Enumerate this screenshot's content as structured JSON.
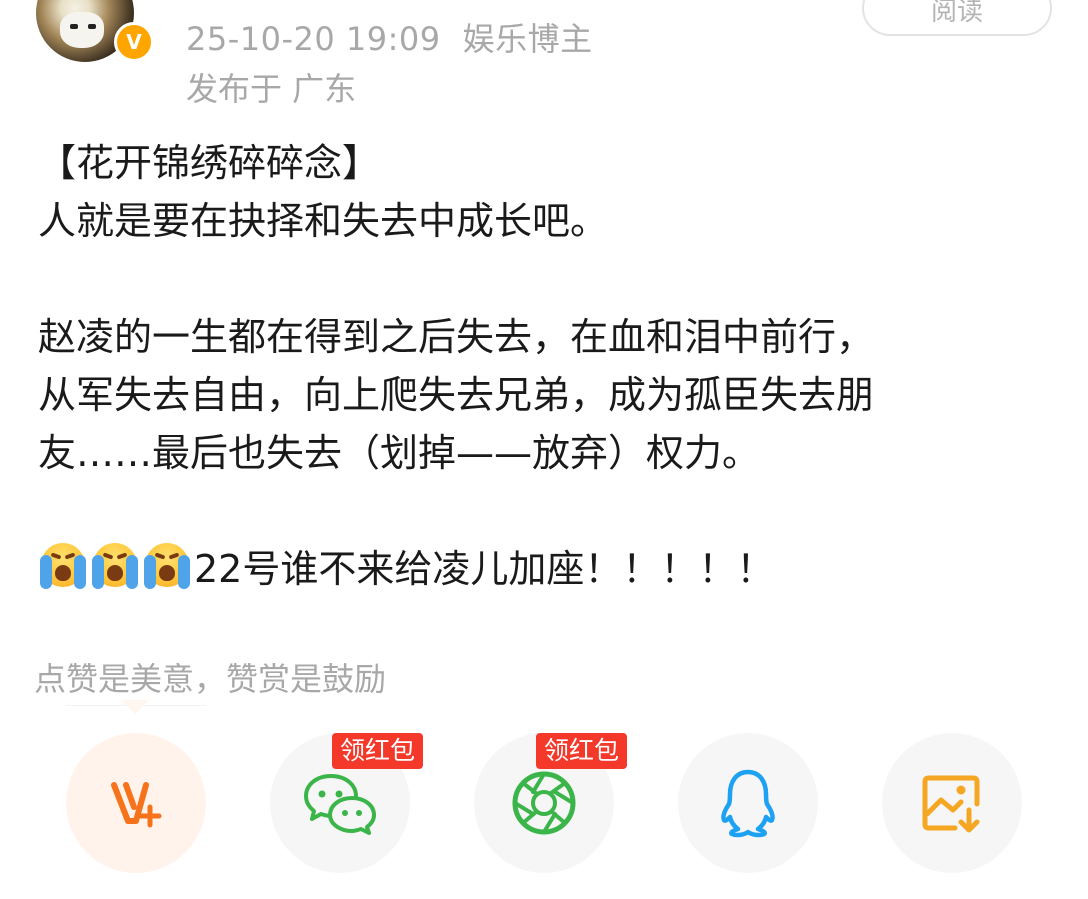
{
  "header": {
    "timestamp": "25-10-20 19:09",
    "role": "娱乐博主",
    "location": "发布于 广东",
    "read_button": "阅读",
    "badge": "V"
  },
  "post": {
    "line1": "【花开锦绣碎碎念】",
    "line2": "人就是要在抉择和失去中成长吧。",
    "line3": "赵凌的一生都在得到之后失去，在血和泪中前行，",
    "line4": "从军失去自由，向上爬失去兄弟，成为孤臣失去朋",
    "line5": "友……最后也失去（划掉——放弃）权力。",
    "line6_text": "22号谁不来给凌儿加座！！！！！",
    "line6_emojis": [
      "crying-face-emoji",
      "crying-face-emoji",
      "crying-face-emoji"
    ]
  },
  "reward": {
    "text": "点赞是美意，赞赏是鼓励"
  },
  "share": {
    "buttons": [
      {
        "icon": "v-plus-icon",
        "color": "#f7731b",
        "active": true
      },
      {
        "icon": "wechat-icon",
        "color": "#3bb54a",
        "tag": "领红包"
      },
      {
        "icon": "moments-icon",
        "color": "#3bb54a",
        "tag": "领红包"
      },
      {
        "icon": "qq-icon",
        "color": "#1da1f2"
      },
      {
        "icon": "save-image-icon",
        "color": "#f5a623"
      }
    ]
  },
  "colors": {
    "accent_orange": "#f7731b",
    "tag_red": "#f4382a",
    "meta_gray": "#a8a8a8"
  }
}
